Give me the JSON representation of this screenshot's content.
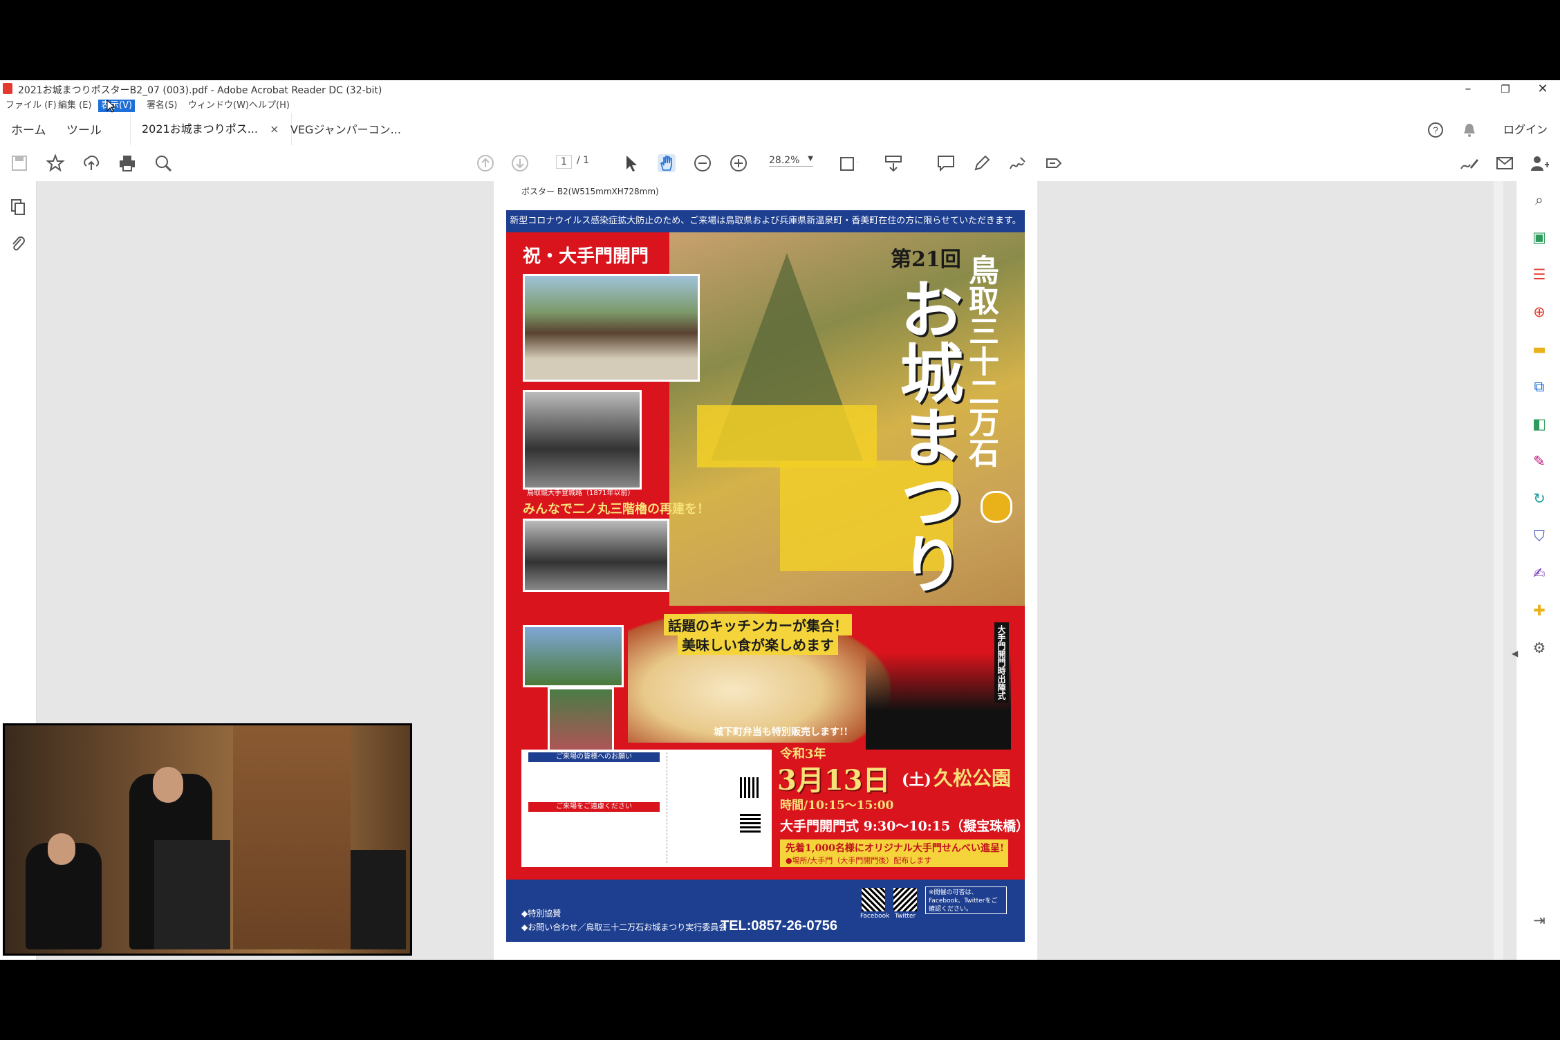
{
  "window": {
    "title": "2021お城まつりポスターB2_07 (003).pdf - Adobe Acrobat Reader DC (32-bit)",
    "controls": {
      "minimize": "–",
      "restore": "❐",
      "close": "✕"
    }
  },
  "menubar": {
    "items": [
      "ファイル (F)",
      "編集 (E)",
      "表示(V)",
      "署名(S)",
      "ウィンドウ(W)",
      "ヘルプ(H)"
    ],
    "active_index": 2
  },
  "tabs": {
    "home": "ホーム",
    "tools": "ツール",
    "doc1": "2021お城まつりポス...",
    "doc1_close": "×",
    "doc2": "VEGジャンパーコン...",
    "login": "ログイン"
  },
  "toolbar": {
    "page_current": "1",
    "page_total": "/ 1",
    "zoom": "28.2%"
  },
  "icons": {
    "save": "save-icon",
    "bookmark": "star-icon",
    "upload": "upload-icon",
    "print": "print-icon",
    "search": "search-icon",
    "prev": "arrow-up-icon",
    "next": "arrow-down-icon",
    "select": "cursor-icon",
    "hand": "hand-icon",
    "zoom_out": "zoom-out-icon",
    "zoom_in": "zoom-in-icon",
    "comment": "comment-icon",
    "pen": "pen-icon",
    "sign": "sign-icon"
  },
  "poster": {
    "size_caption": "ポスター B2(W515mmXH728mm)",
    "banner": "新型コロナウイルス感染症拡大防止のため、ご来場は鳥取県および兵庫県新温泉町・香美町在住の方に限らせていただきます。",
    "heading_gate": "祝・大手門開門",
    "edition": "第21回",
    "vertical_title_top": "鳥取三十二万石",
    "vertical_title_main": "お城まつり",
    "photo_caption_1": "鳥取城大手登城路（1871年以前）",
    "heading_rebuild": "みんなで二ノ丸三階櫓の再建を！",
    "kitchen_car": "話題のキッチンカーが集合！",
    "delicious": "美味しい食が楽しめます",
    "bento": "城下町弁当も特別販売します!!",
    "era": "令和3年",
    "date": "3月13日",
    "day": "(土)",
    "venue": "久松公園",
    "time": "時間/10:15〜15:00",
    "gate_ceremony": "大手門開門式 9:30〜10:15（擬宝珠橋）",
    "gift": "先着1,000名様にオリジナル大手門せんべい進呈!",
    "gift_note": "●場所/大手門（大手門開門後）配布します",
    "notice_title": "ご来場の皆様へのお願い",
    "notice_sub": "ご来場をご遠慮ください",
    "parade_vertical": "大手門開門時出陣式",
    "contact_label": "◆お問い合わせ／鳥取三十二万石お城まつり実行委員会",
    "tel": "TEL:0857-26-0756",
    "sponsor_label": "◆特別協賛",
    "facebook": "Facebook",
    "twitter": "Twitter",
    "sns_note": "※開催の可否は、Facebook、Twitterをご確認ください。"
  }
}
